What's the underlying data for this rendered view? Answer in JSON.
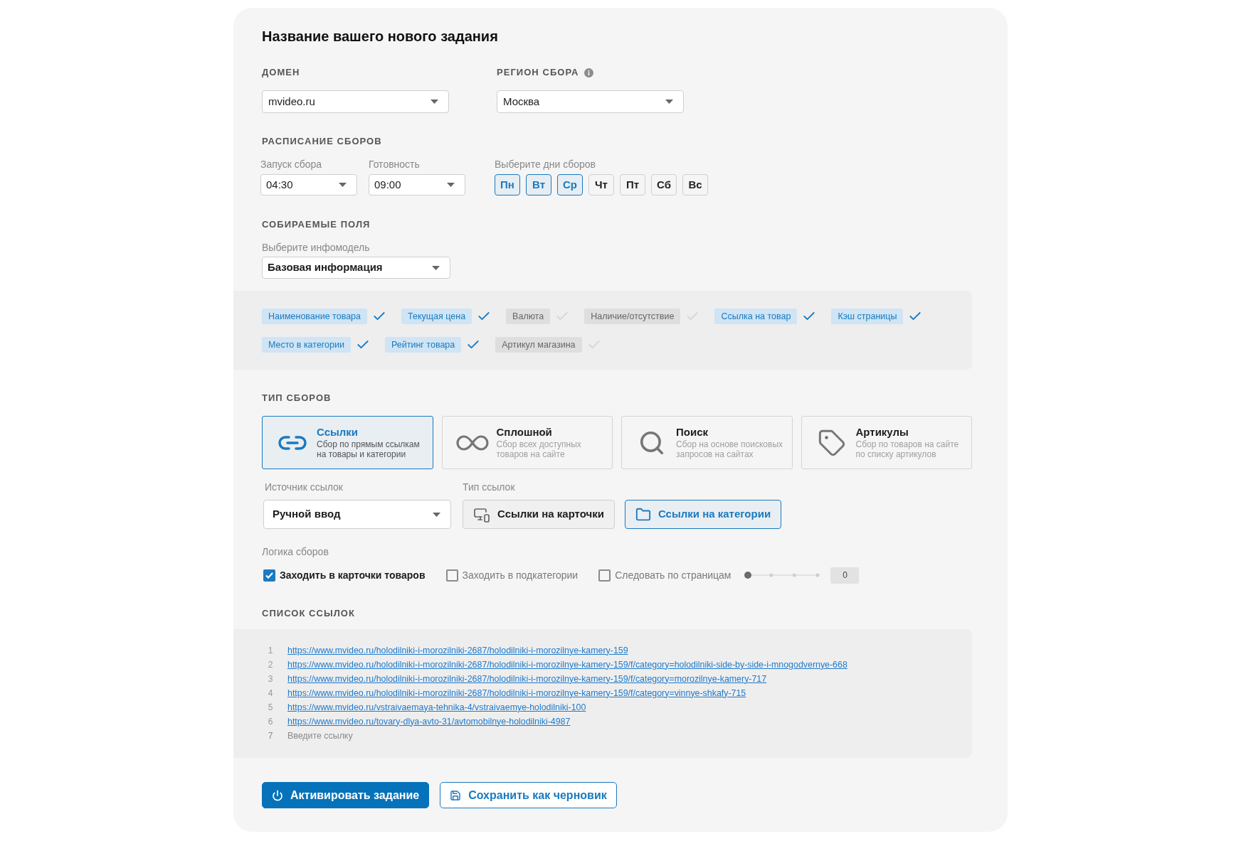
{
  "title": "Название вашего нового задания",
  "domain": {
    "label": "ДОМЕН",
    "value": "mvideo.ru"
  },
  "region": {
    "label": "РЕГИОН СБОРА",
    "value": "Москва"
  },
  "schedule": {
    "heading": "РАСПИСАНИЕ СБОРОВ",
    "start": {
      "label": "Запуск сбора",
      "value": "04:30"
    },
    "ready": {
      "label": "Готовность",
      "value": "09:00"
    },
    "days_label": "Выберите дни сборов",
    "days": [
      {
        "label": "Пн",
        "selected": true
      },
      {
        "label": "Вт",
        "selected": true
      },
      {
        "label": "Ср",
        "selected": true
      },
      {
        "label": "Чт",
        "selected": false
      },
      {
        "label": "Пт",
        "selected": false
      },
      {
        "label": "Сб",
        "selected": false
      },
      {
        "label": "Вс",
        "selected": false
      }
    ]
  },
  "fields": {
    "heading": "СОБИРАЕМЫЕ ПОЛЯ",
    "model_label": "Выберите инфомодель",
    "model_value": "Базовая информация",
    "items": [
      {
        "label": "Наименование товара",
        "checked": true
      },
      {
        "label": "Текущая цена",
        "checked": true
      },
      {
        "label": "Валюта",
        "checked": false
      },
      {
        "label": "Наличие/отсутствие",
        "checked": false
      },
      {
        "label": "Ссылка на товар",
        "checked": true
      },
      {
        "label": "Кэш страницы",
        "checked": true
      },
      {
        "label": "Место в категории",
        "checked": true
      },
      {
        "label": "Рейтинг товара",
        "checked": true
      },
      {
        "label": "Артикул магазина",
        "checked": false
      }
    ]
  },
  "collection_type": {
    "heading": "ТИП СБОРОВ",
    "options": [
      {
        "title": "Ссылки",
        "description": "Сбор по прямым ссылкам на товары и категории",
        "selected": true
      },
      {
        "title": "Сплошной",
        "description": "Сбор всех доступных товаров на сайте",
        "selected": false
      },
      {
        "title": "Поиск",
        "description": "Сбор на основе поисковых запросов на сайтах",
        "selected": false
      },
      {
        "title": "Артикулы",
        "description": "Сбор по товаров на сайте по списку артикулов",
        "selected": false
      }
    ]
  },
  "links": {
    "source_label": "Источник ссылок",
    "source_value": "Ручной ввод",
    "type_label": "Тип ссылок",
    "types": [
      {
        "label": "Ссылки на карточки",
        "selected": false
      },
      {
        "label": "Ссылки на категории",
        "selected": true
      }
    ]
  },
  "logic": {
    "label": "Логика сборов",
    "options": [
      {
        "label": "Заходить в карточки товаров",
        "checked": true
      },
      {
        "label": "Заходить в подкатегории",
        "checked": false
      },
      {
        "label": "Следовать по страницам",
        "checked": false
      }
    ],
    "depth": {
      "level": 0,
      "value": "0"
    }
  },
  "link_list": {
    "heading": "СПИСОК ССЫЛОК",
    "rows": [
      {
        "number": "1",
        "url": "https://www.mvideo.ru/holodilniki-i-morozilniki-2687/holodilniki-i-morozilnye-kamery-159"
      },
      {
        "number": "2",
        "url": "https://www.mvideo.ru/holodilniki-i-morozilniki-2687/holodilniki-i-morozilnye-kamery-159/f/category=holodilniki-side-by-side-i-mnogodvernye-668"
      },
      {
        "number": "3",
        "url": "https://www.mvideo.ru/holodilniki-i-morozilniki-2687/holodilniki-i-morozilnye-kamery-159/f/category=morozilnye-kamery-717"
      },
      {
        "number": "4",
        "url": "https://www.mvideo.ru/holodilniki-i-morozilniki-2687/holodilniki-i-morozilnye-kamery-159/f/category=vinnye-shkafy-715"
      },
      {
        "number": "5",
        "url": "https://www.mvideo.ru/vstraivaemaya-tehnika-4/vstraivaemye-holodilniki-100"
      },
      {
        "number": "6",
        "url": "https://www.mvideo.ru/tovary-dlya-avto-31/avtomobilnye-holodilniki-4987"
      }
    ],
    "new_row": {
      "number": "7",
      "placeholder": "Введите ссылку"
    }
  },
  "actions": [
    {
      "label": "Активировать задание",
      "kind": "primary"
    },
    {
      "label": "Сохранить как черновик",
      "kind": "secondary"
    }
  ]
}
